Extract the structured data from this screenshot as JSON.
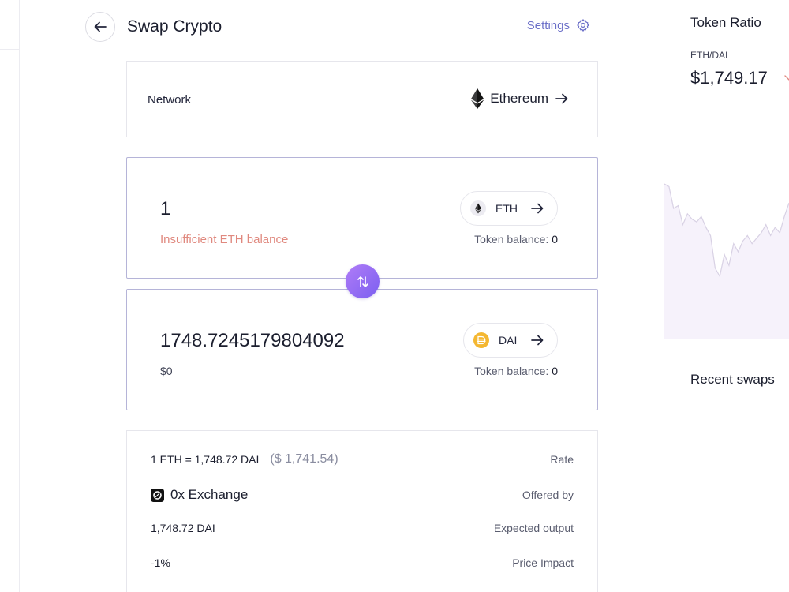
{
  "header": {
    "title": "Swap Crypto",
    "settings_label": "Settings"
  },
  "network": {
    "label": "Network",
    "value": "Ethereum"
  },
  "from": {
    "amount": "1",
    "message": "Insufficient ETH balance",
    "token": "ETH",
    "balance_label": "Token balance:",
    "balance_value": "0"
  },
  "to": {
    "amount": "1748.7245179804092",
    "usd_value": "$0",
    "token": "DAI",
    "balance_label": "Token balance:",
    "balance_value": "0"
  },
  "details": {
    "rate_value": "1 ETH = 1,748.72 DAI",
    "rate_usd": "($ 1,741.54)",
    "rate_label": "Rate",
    "provider_name": "0x Exchange",
    "provider_label": "Offered by",
    "output_value": "1,748.72 DAI",
    "output_label": "Expected output",
    "impact_value": "-1%",
    "impact_label": "Price Impact"
  },
  "ratio_panel": {
    "title": "Token Ratio",
    "pair": "ETH/DAI",
    "price": "$1,749.17",
    "recent_title": "Recent swaps"
  },
  "chart_data": {
    "type": "area",
    "series": [
      {
        "values": [
          1752,
          1751,
          1743,
          1744,
          1737,
          1741,
          1739,
          1738,
          1740,
          1736,
          1733,
          1721,
          1718,
          1726,
          1722,
          1730,
          1727,
          1731,
          1733,
          1730,
          1732,
          1734,
          1737,
          1733,
          1736,
          1734,
          1740,
          1745
        ]
      }
    ]
  },
  "colors": {
    "accent": "#6b6fc8",
    "error": "#e0897f",
    "card_border_active": "#b5b4d8",
    "toggle_gradient_start": "#b07cf7",
    "toggle_gradient_end": "#7b5ff0",
    "dai_gold": "#f4b731"
  },
  "icons": {
    "back": "arrow-left-icon",
    "settings": "gear-icon",
    "network": "ethereum-icon",
    "swap": "swap-vertical-icon",
    "provider": "0x-logo-icon"
  }
}
